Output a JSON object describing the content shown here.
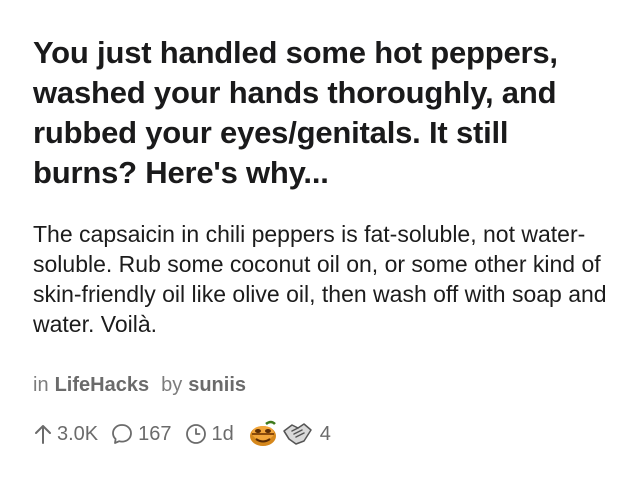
{
  "post": {
    "title": "You just handled some hot peppers, washed your hands thoroughly, and rubbed your eyes/genitals. It still burns? Here's why...",
    "body": "The capsaicin in chili peppers is fat-soluble, not water-soluble. Rub some coconut oil on, or some other kind of skin-friendly oil like olive oil, then wash off with soap and water. Voilà.",
    "meta": {
      "in_label": "in",
      "subreddit": "LifeHacks",
      "by_label": "by",
      "author": "suniis"
    },
    "actions": {
      "upvotes": "3.0K",
      "comments": "167",
      "age": "1d",
      "award_count": "4"
    },
    "icons": [
      "upvote-arrow-icon",
      "comment-bubble-icon",
      "clock-icon",
      "hot-pepper-award-icon",
      "handshake-award-icon"
    ]
  }
}
